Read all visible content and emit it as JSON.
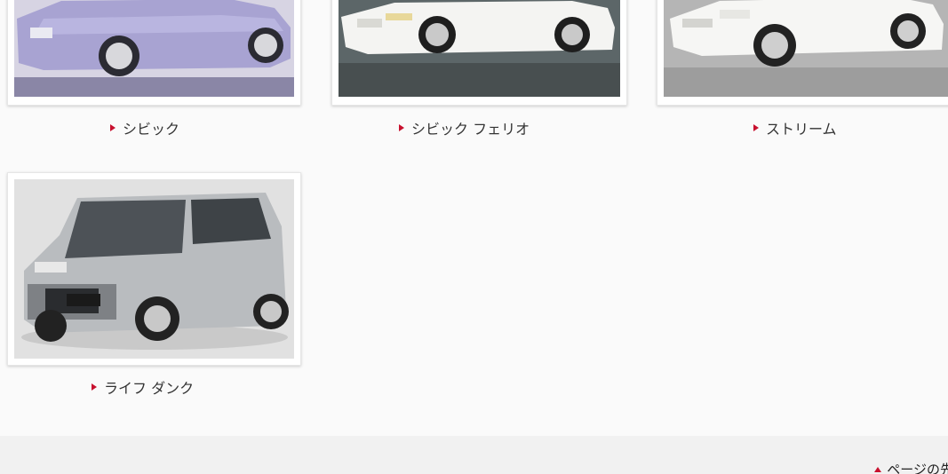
{
  "cars": [
    {
      "label": "シビック"
    },
    {
      "label": "シビック フェリオ"
    },
    {
      "label": "ストリーム"
    },
    {
      "label": "ライフ ダンク"
    }
  ],
  "footer": {
    "page_top_label": "ページの先"
  },
  "colors": {
    "accent": "#c8102e",
    "background": "#fafafa",
    "footer_bg": "#f1f1f1"
  },
  "icons": {
    "caption_marker": "arrow-right-icon",
    "page_top_marker": "arrow-up-icon"
  }
}
